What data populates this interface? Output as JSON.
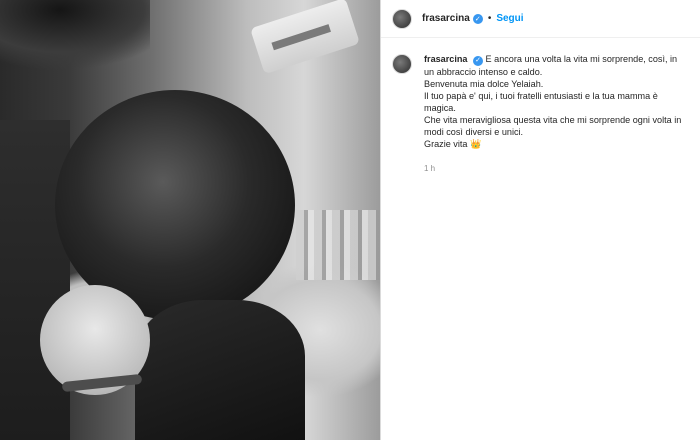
{
  "post": {
    "username": "frasarcina",
    "follow_label": "Segui",
    "separator": "•",
    "verified_glyph": "✓",
    "caption_first": "E ancora una volta la vita mi sorprende, così, in un abbraccio intenso e caldo.",
    "caption_lines": [
      "Benvenuta mia dolce Yelaiah.",
      "Il tuo papà e' qui, i tuoi fratelli entusiasti e la tua mamma è magica.",
      "Che vita meravigliosa questa vita che mi sorprende ogni volta in modi così diversi e unici.",
      "Grazie vita 👑"
    ],
    "time": "1 h"
  },
  "colors": {
    "link": "#0095f6",
    "verified": "#3897f0",
    "text": "#262626",
    "muted": "#8e8e8e"
  },
  "icons": [
    "avatar",
    "verified-badge-icon",
    "crown-emoji"
  ]
}
